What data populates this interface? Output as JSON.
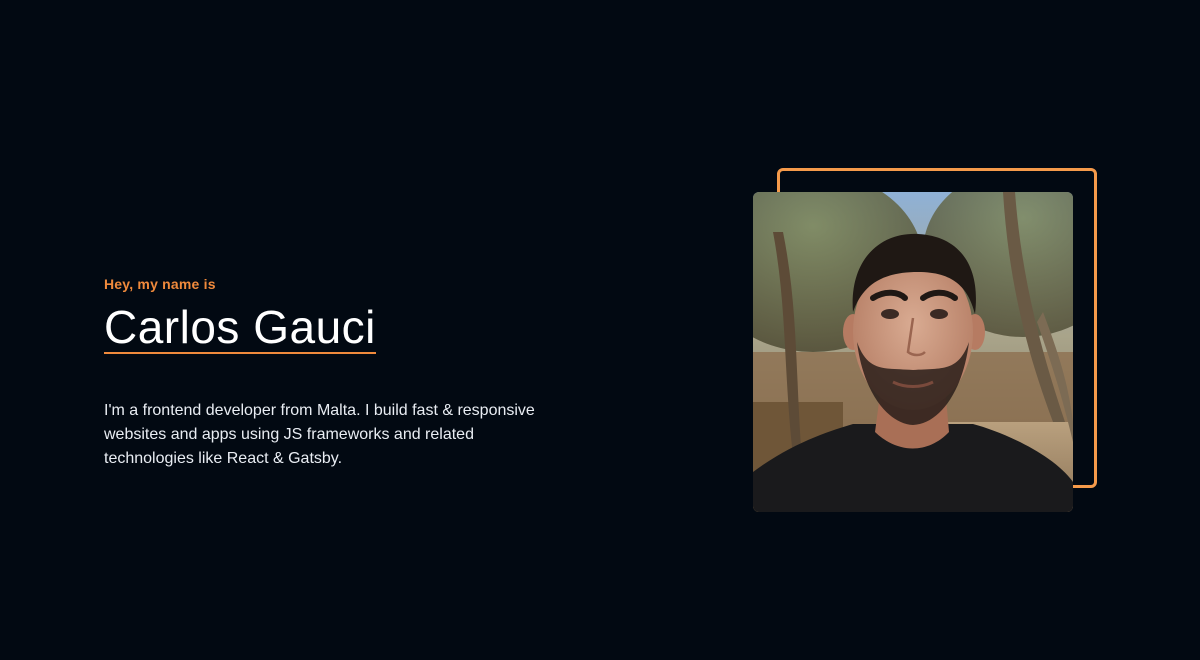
{
  "hero": {
    "greeting": "Hey, my name is",
    "name": "Carlos Gauci",
    "bio": "I'm a frontend developer from Malta. I build fast & responsive websites and apps using JS frameworks and related technologies like React & Gatsby."
  },
  "colors": {
    "background": "#020912",
    "accent": "#f08a3c",
    "text": "#ffffff"
  }
}
